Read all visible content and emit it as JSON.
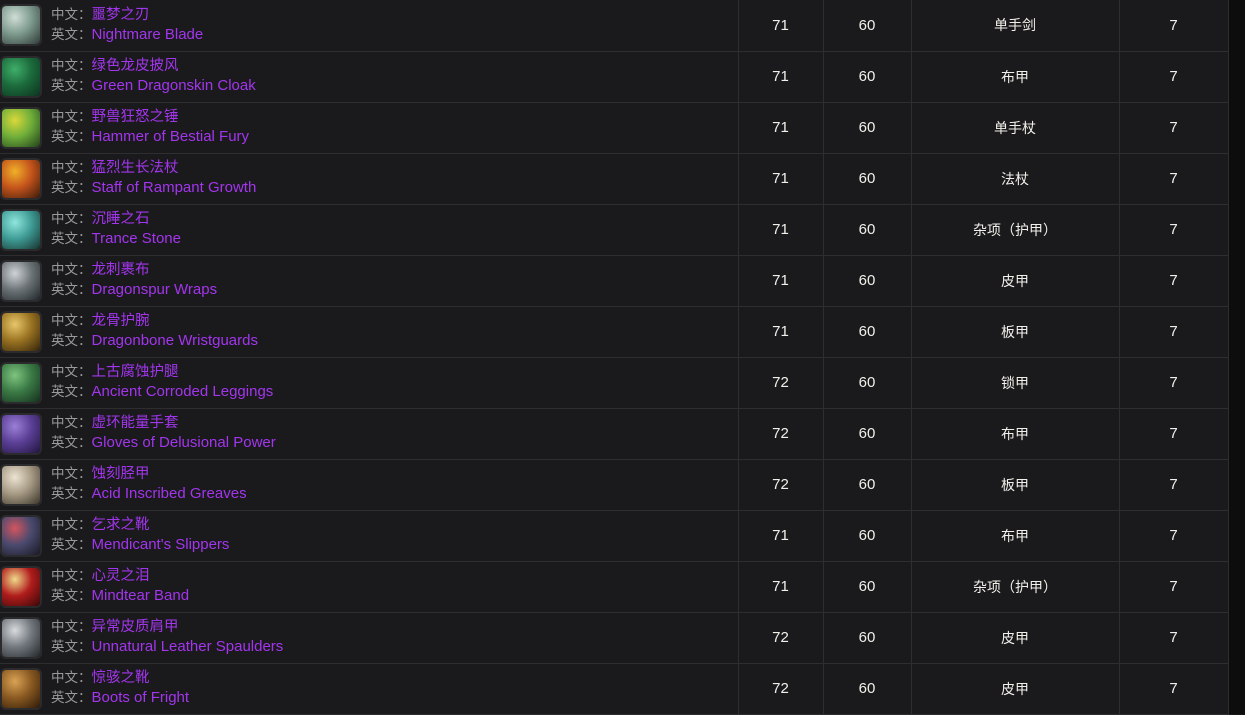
{
  "labels": {
    "cn": "中文：",
    "en": "英文："
  },
  "rows": [
    {
      "icon": "sword-icon",
      "icon_colors": [
        "#cfded6",
        "#7e9a8e",
        "#2f3a36"
      ],
      "name_cn": "噩梦之刃",
      "name_en": "Nightmare Blade",
      "ilvl": "71",
      "req_level": "60",
      "type": "单手剑",
      "slot": "7"
    },
    {
      "icon": "cloak-icon",
      "icon_colors": [
        "#3fae6a",
        "#1c6b3c",
        "#0d3320"
      ],
      "name_cn": "绿色龙皮披风",
      "name_en": "Green Dragonskin Cloak",
      "ilvl": "71",
      "req_level": "60",
      "type": "布甲",
      "slot": "7"
    },
    {
      "icon": "hammer-icon",
      "icon_colors": [
        "#d9d83a",
        "#6fae3a",
        "#22401a"
      ],
      "name_cn": "野兽狂怒之锤",
      "name_en": "Hammer of Bestial Fury",
      "ilvl": "71",
      "req_level": "60",
      "type": "单手杖",
      "slot": "7"
    },
    {
      "icon": "staff-icon",
      "icon_colors": [
        "#f0b02a",
        "#c4541c",
        "#3c1b0a"
      ],
      "name_cn": "猛烈生长法杖",
      "name_en": "Staff of Rampant Growth",
      "ilvl": "71",
      "req_level": "60",
      "type": "法杖",
      "slot": "7"
    },
    {
      "icon": "orb-icon",
      "icon_colors": [
        "#8fe6dd",
        "#3f9c96",
        "#17332f"
      ],
      "name_cn": "沉睡之石",
      "name_en": "Trance Stone",
      "ilvl": "71",
      "req_level": "60",
      "type": "杂项（护甲）",
      "slot": "7"
    },
    {
      "icon": "bracer-wraps-icon",
      "icon_colors": [
        "#cfd3d6",
        "#6d7478",
        "#20262a"
      ],
      "name_cn": "龙刺裹布",
      "name_en": "Dragonspur Wraps",
      "ilvl": "71",
      "req_level": "60",
      "type": "皮甲",
      "slot": "7"
    },
    {
      "icon": "wristguard-icon",
      "icon_colors": [
        "#e7c76a",
        "#9a7322",
        "#33240a"
      ],
      "name_cn": "龙骨护腕",
      "name_en": "Dragonbone Wristguards",
      "ilvl": "71",
      "req_level": "60",
      "type": "板甲",
      "slot": "7"
    },
    {
      "icon": "leggings-icon",
      "icon_colors": [
        "#7ec47e",
        "#3b7a46",
        "#14301c"
      ],
      "name_cn": "上古腐蚀护腿",
      "name_en": "Ancient Corroded Leggings",
      "ilvl": "72",
      "req_level": "60",
      "type": "锁甲",
      "slot": "7"
    },
    {
      "icon": "gloves-icon",
      "icon_colors": [
        "#9a7fd6",
        "#5b3f96",
        "#221540"
      ],
      "name_cn": "虚环能量手套",
      "name_en": "Gloves of Delusional Power",
      "ilvl": "72",
      "req_level": "60",
      "type": "布甲",
      "slot": "7"
    },
    {
      "icon": "greaves-icon",
      "icon_colors": [
        "#ece3d2",
        "#a69a84",
        "#3a342a"
      ],
      "name_cn": "蚀刻胫甲",
      "name_en": "Acid Inscribed Greaves",
      "ilvl": "72",
      "req_level": "60",
      "type": "板甲",
      "slot": "7"
    },
    {
      "icon": "slippers-icon",
      "icon_colors": [
        "#d2555f",
        "#4a4a6e",
        "#191926"
      ],
      "name_cn": "乞求之靴",
      "name_en": "Mendicant's Slippers",
      "ilvl": "71",
      "req_level": "60",
      "type": "布甲",
      "slot": "7"
    },
    {
      "icon": "ring-icon",
      "icon_colors": [
        "#f0d98a",
        "#b01c1c",
        "#3a0808"
      ],
      "name_cn": "心灵之泪",
      "name_en": "Mindtear Band",
      "ilvl": "71",
      "req_level": "60",
      "type": "杂项（护甲）",
      "slot": "7"
    },
    {
      "icon": "spaulders-icon",
      "icon_colors": [
        "#d8dadd",
        "#72787e",
        "#23272b"
      ],
      "name_cn": "异常皮质肩甲",
      "name_en": "Unnatural Leather Spaulders",
      "ilvl": "72",
      "req_level": "60",
      "type": "皮甲",
      "slot": "7"
    },
    {
      "icon": "boots-icon",
      "icon_colors": [
        "#d9a255",
        "#8a5a22",
        "#2e1a08"
      ],
      "name_cn": "惊骇之靴",
      "name_en": "Boots of Fright",
      "ilvl": "72",
      "req_level": "60",
      "type": "皮甲",
      "slot": "7"
    }
  ]
}
